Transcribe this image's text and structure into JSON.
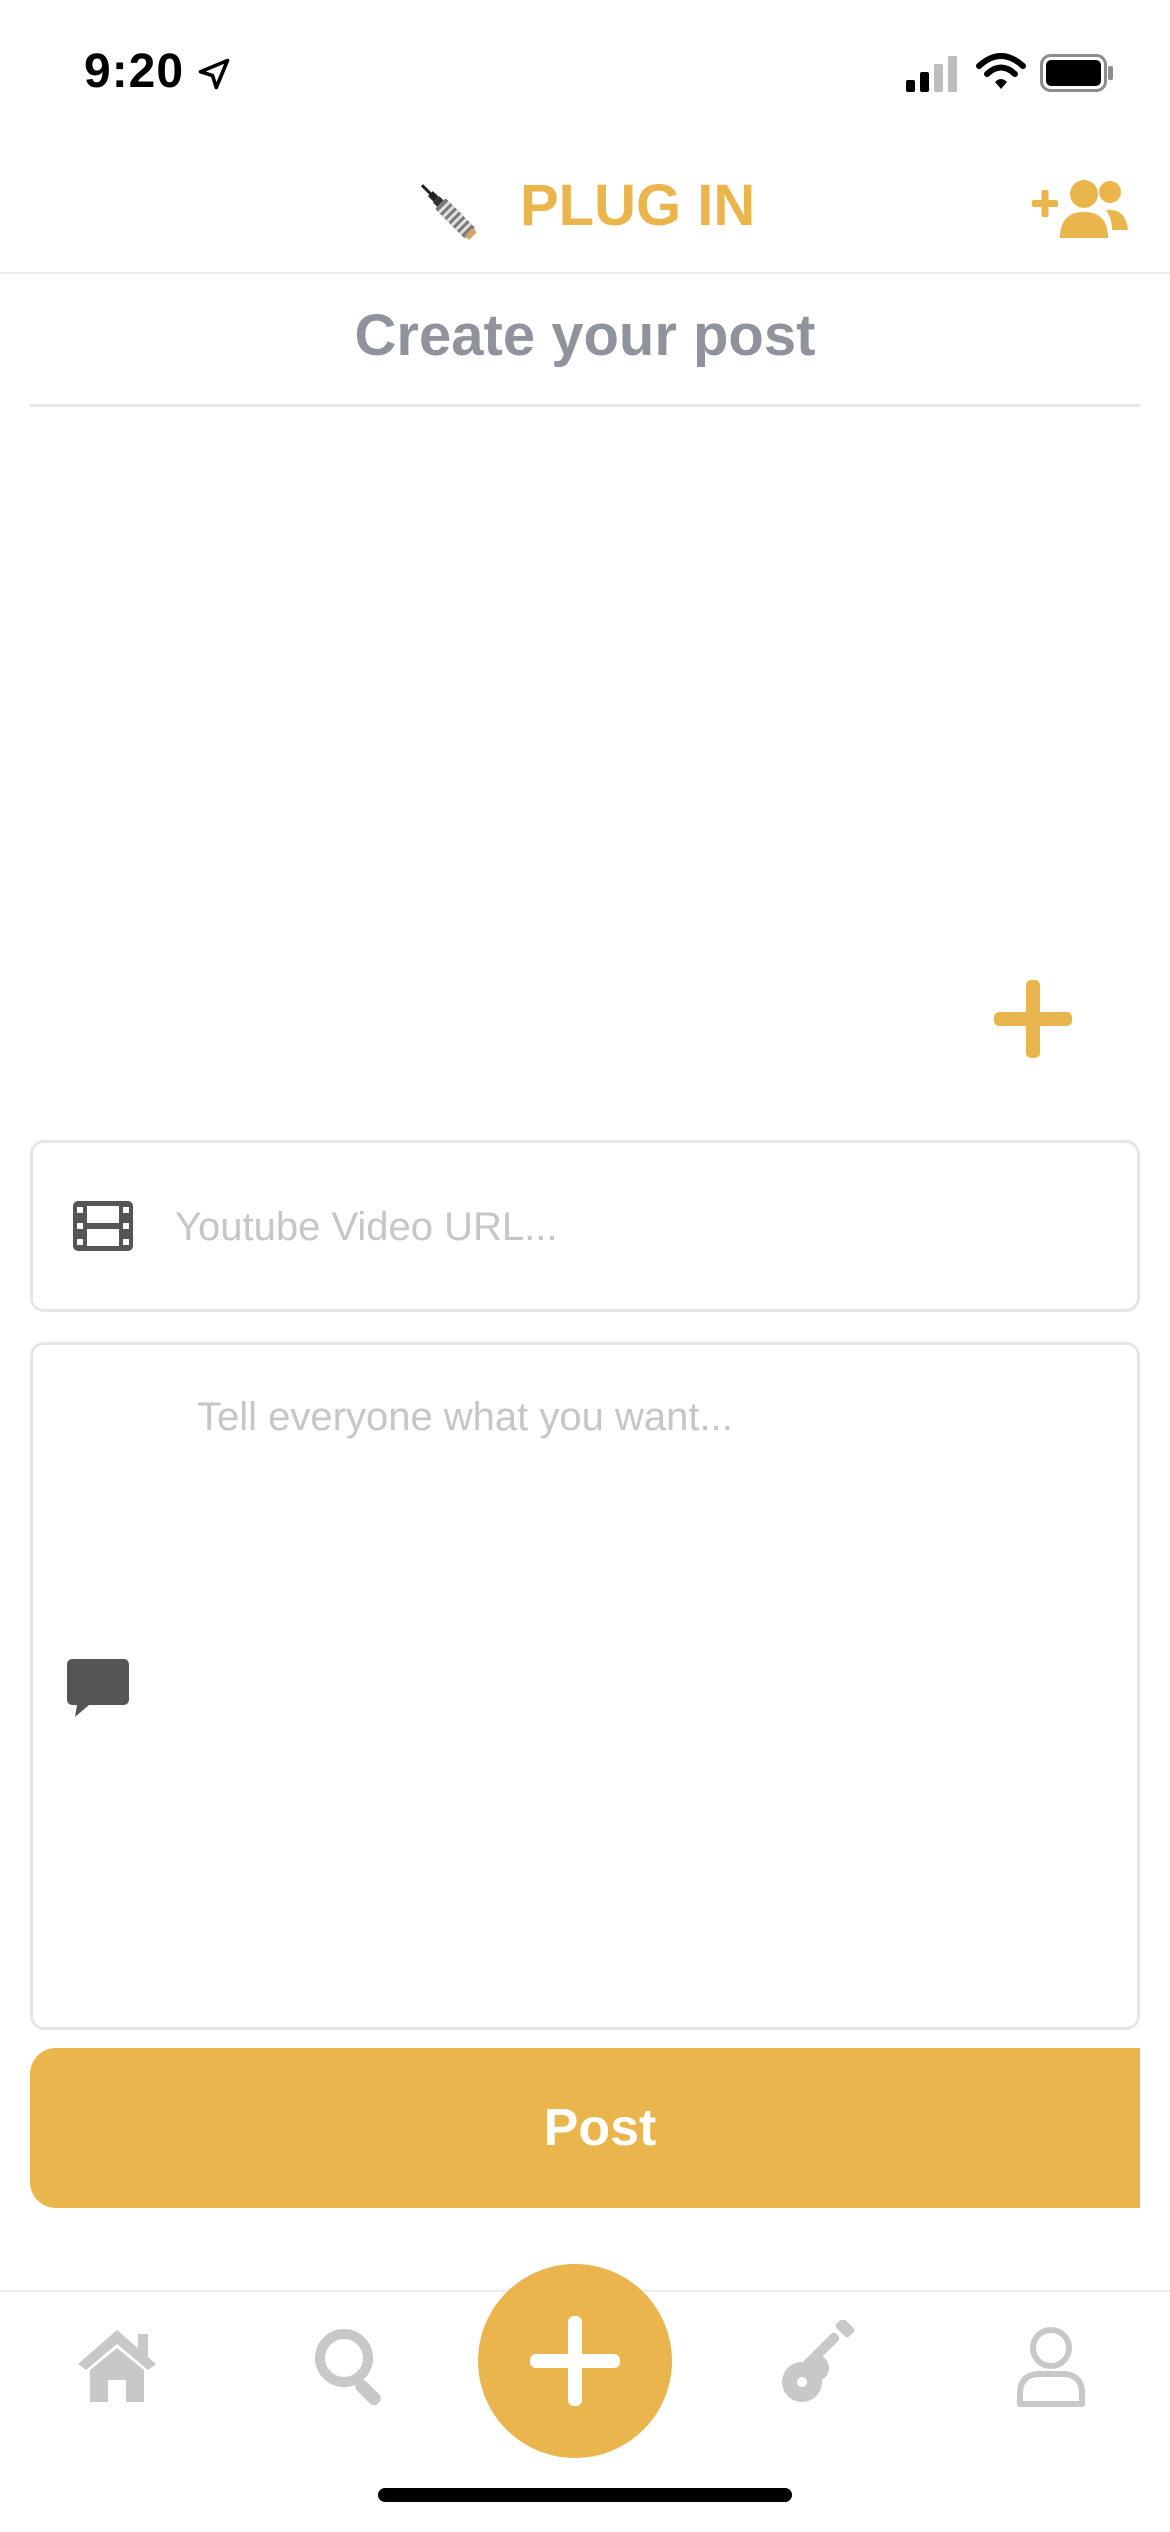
{
  "status_bar": {
    "time": "9:20",
    "icons": [
      "location-arrow-icon",
      "signal-icon",
      "wifi-icon",
      "battery-icon"
    ]
  },
  "header": {
    "title": "PLUG IN",
    "logo_icon": "audio-jack-plug-icon",
    "right_action_icon": "add-friends-icon"
  },
  "page": {
    "title": "Create your post"
  },
  "form": {
    "add_media_icon": "plus-icon",
    "url_field": {
      "placeholder": "Youtube Video URL...",
      "value": "",
      "icon": "film-icon"
    },
    "message_field": {
      "placeholder": "Tell everyone what you want...",
      "value": "",
      "icon": "chat-bubble-icon"
    },
    "post_label": "Post"
  },
  "tab_bar": {
    "tabs": [
      {
        "name": "home",
        "icon": "home-icon"
      },
      {
        "name": "search",
        "icon": "search-icon"
      },
      {
        "name": "create",
        "icon": "plus-icon",
        "active": true
      },
      {
        "name": "instruments",
        "icon": "guitar-icon"
      },
      {
        "name": "profile",
        "icon": "user-icon"
      }
    ]
  },
  "colors": {
    "accent": "#ebb54e",
    "title_gray": "#8f939b",
    "icon_gray": "#c8c8c8",
    "icon_dark": "#555555",
    "border": "#e6e6e6"
  }
}
